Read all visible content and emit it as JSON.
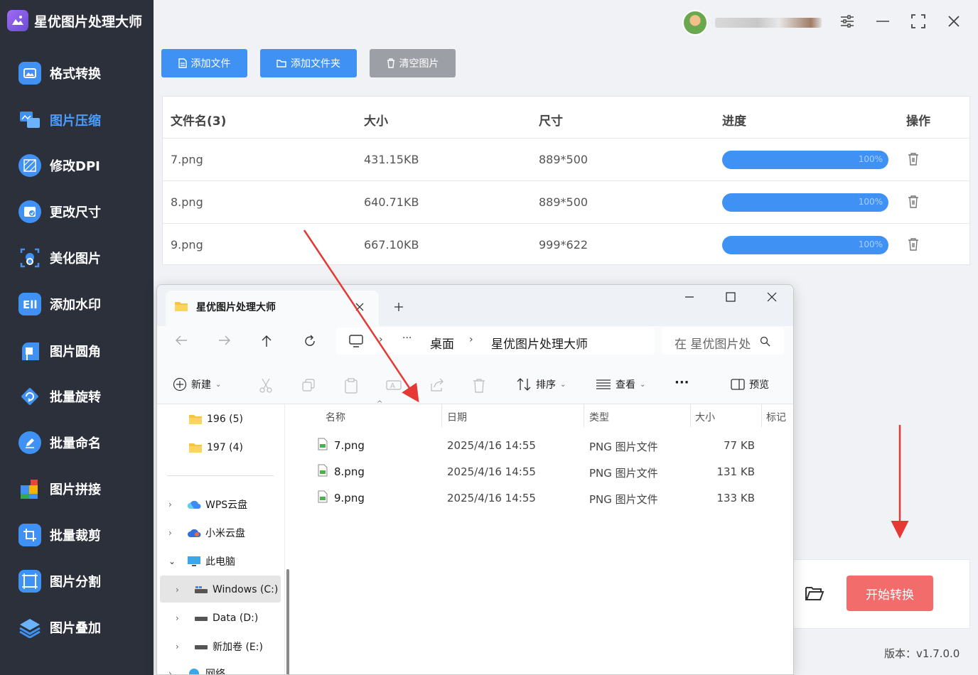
{
  "app": {
    "title": "星优图片处理大师",
    "version": "版本：v1.7.0.0"
  },
  "sidebar": {
    "items": [
      {
        "label": "格式转换",
        "icon": "image-convert-icon",
        "active": false
      },
      {
        "label": "图片压缩",
        "icon": "image-compress-icon",
        "active": true
      },
      {
        "label": "修改DPI",
        "icon": "dpi-icon",
        "active": false
      },
      {
        "label": "更改尺寸",
        "icon": "resize-icon",
        "active": false
      },
      {
        "label": "美化图片",
        "icon": "beautify-icon",
        "active": false
      },
      {
        "label": "添加水印",
        "icon": "watermark-icon",
        "active": false
      },
      {
        "label": "图片圆角",
        "icon": "rounded-corner-icon",
        "active": false
      },
      {
        "label": "批量旋转",
        "icon": "rotate-icon",
        "active": false
      },
      {
        "label": "批量命名",
        "icon": "rename-icon",
        "active": false
      },
      {
        "label": "图片拼接",
        "icon": "puzzle-icon",
        "active": false
      },
      {
        "label": "批量裁剪",
        "icon": "crop-icon",
        "active": false
      },
      {
        "label": "图片分割",
        "icon": "split-icon",
        "active": false
      },
      {
        "label": "图片叠加",
        "icon": "layers-icon",
        "active": false
      }
    ]
  },
  "toolbar": {
    "add_file": "添加文件",
    "add_folder": "添加文件夹",
    "clear": "清空图片"
  },
  "table": {
    "headers": {
      "name": "文件名(3)",
      "size": "大小",
      "dims": "尺寸",
      "progress": "进度",
      "action": "操作"
    },
    "rows": [
      {
        "name": "7.png",
        "size": "431.15KB",
        "dims": "889*500",
        "progress_text": "100%",
        "progress": 1.0
      },
      {
        "name": "8.png",
        "size": "640.71KB",
        "dims": "889*500",
        "progress_text": "100%",
        "progress": 1.0
      },
      {
        "name": "9.png",
        "size": "667.10KB",
        "dims": "999*622",
        "progress_text": "100%",
        "progress": 1.0
      }
    ]
  },
  "start_button": "开始转换",
  "explorer": {
    "tab_title": "星优图片处理大师",
    "breadcrumb": [
      "桌面",
      "星优图片处理大师"
    ],
    "breadcrumb_more": "···",
    "search_placeholder": "在 星优图片处",
    "commands": {
      "new": "新建",
      "sort": "排序",
      "view": "查看",
      "more": "···",
      "preview": "预览"
    },
    "tree": {
      "folders": [
        {
          "label": "196 (5)"
        },
        {
          "label": "197 (4)"
        }
      ],
      "items": [
        {
          "label": "WPS云盘"
        },
        {
          "label": "小米云盘"
        },
        {
          "label": "此电脑"
        },
        {
          "label": "Windows (C:)"
        },
        {
          "label": "Data (D:)"
        },
        {
          "label": "新加卷 (E:)"
        },
        {
          "label": "网络"
        }
      ]
    },
    "columns": {
      "name": "名称",
      "date": "日期",
      "type": "类型",
      "size": "大小",
      "tag": "标记"
    },
    "files": [
      {
        "name": "7.png",
        "date": "2025/4/16 14:55",
        "type": "PNG 图片文件",
        "size": "77 KB"
      },
      {
        "name": "8.png",
        "date": "2025/4/16 14:55",
        "type": "PNG 图片文件",
        "size": "131 KB"
      },
      {
        "name": "9.png",
        "date": "2025/4/16 14:55",
        "type": "PNG 图片文件",
        "size": "133 KB"
      }
    ]
  },
  "colors": {
    "sidebar_bg": "#2b303a",
    "accent": "#3f92f4",
    "start_button": "#f26c6c",
    "arrow": "#e53935"
  }
}
